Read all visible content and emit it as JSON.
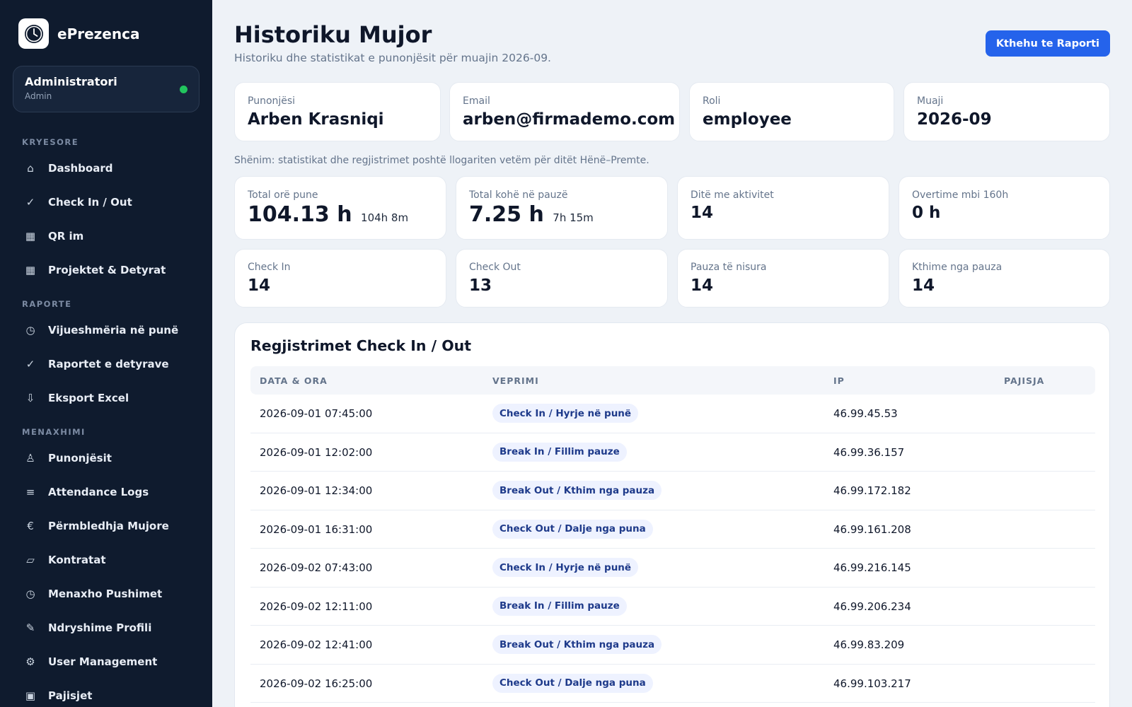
{
  "app": {
    "name": "ePrezenca"
  },
  "user": {
    "name": "Administratori",
    "role": "Admin"
  },
  "sidebar": {
    "sections": [
      {
        "label": "KRYESORE"
      },
      {
        "label": "RAPORTE"
      },
      {
        "label": "MENAXHIMI"
      }
    ],
    "items": [
      {
        "label": "Dashboard",
        "icon": "⌂"
      },
      {
        "label": "Check In / Out",
        "icon": "✓"
      },
      {
        "label": "QR im",
        "icon": "▦"
      },
      {
        "label": "Projektet & Detyrat",
        "icon": "▦"
      },
      {
        "label": "Vijueshmëria në punë",
        "icon": "◷"
      },
      {
        "label": "Raportet e detyrave",
        "icon": "✓"
      },
      {
        "label": "Eksport Excel",
        "icon": "⇩"
      },
      {
        "label": "Punonjësit",
        "icon": "♙"
      },
      {
        "label": "Attendance Logs",
        "icon": "≡"
      },
      {
        "label": "Përmbledhja Mujore",
        "icon": "€"
      },
      {
        "label": "Kontratat",
        "icon": "▱"
      },
      {
        "label": "Menaxho Pushimet",
        "icon": "◷"
      },
      {
        "label": "Ndryshime Profili",
        "icon": "✎"
      },
      {
        "label": "User Management",
        "icon": "⚙"
      },
      {
        "label": "Pajisjet",
        "icon": "▣"
      }
    ]
  },
  "header": {
    "title": "Historiku Mujor",
    "subtitle": "Historiku dhe statistikat e punonjësit për muajin 2026-09.",
    "back_button": "Kthehu te Raporti"
  },
  "info": [
    {
      "label": "Punonjësi",
      "value": "Arben Krasniqi"
    },
    {
      "label": "Email",
      "value": "arben@firmademo.com"
    },
    {
      "label": "Roli",
      "value": "employee"
    },
    {
      "label": "Muaji",
      "value": "2026-09"
    }
  ],
  "note": "Shënim: statistikat dhe regjistrimet poshtë llogariten vetëm për ditët Hënë–Premte.",
  "stats_row1": [
    {
      "label": "Total orë pune",
      "value": "104.13 h",
      "sub": "104h 8m"
    },
    {
      "label": "Total kohë në pauzë",
      "value": "7.25 h",
      "sub": "7h 15m"
    },
    {
      "label": "Ditë me aktivitet",
      "value": "14",
      "sub": ""
    },
    {
      "label": "Overtime mbi 160h",
      "value": "0 h",
      "sub": ""
    }
  ],
  "stats_row2": [
    {
      "label": "Check In",
      "value": "14"
    },
    {
      "label": "Check Out",
      "value": "13"
    },
    {
      "label": "Pauza të nisura",
      "value": "14"
    },
    {
      "label": "Kthime nga pauza",
      "value": "14"
    }
  ],
  "table": {
    "title": "Regjistrimet Check In / Out",
    "columns": [
      "DATA & ORA",
      "VEPRIMI",
      "IP",
      "PAJISJA"
    ],
    "rows": [
      {
        "datetime": "2026-09-01 07:45:00",
        "action": "Check In / Hyrje në punë",
        "ip": "46.99.45.53",
        "device": ""
      },
      {
        "datetime": "2026-09-01 12:02:00",
        "action": "Break In / Fillim pauze",
        "ip": "46.99.36.157",
        "device": ""
      },
      {
        "datetime": "2026-09-01 12:34:00",
        "action": "Break Out / Kthim nga pauza",
        "ip": "46.99.172.182",
        "device": ""
      },
      {
        "datetime": "2026-09-01 16:31:00",
        "action": "Check Out / Dalje nga puna",
        "ip": "46.99.161.208",
        "device": ""
      },
      {
        "datetime": "2026-09-02 07:43:00",
        "action": "Check In / Hyrje në punë",
        "ip": "46.99.216.145",
        "device": ""
      },
      {
        "datetime": "2026-09-02 12:11:00",
        "action": "Break In / Fillim pauze",
        "ip": "46.99.206.234",
        "device": ""
      },
      {
        "datetime": "2026-09-02 12:41:00",
        "action": "Break Out / Kthim nga pauza",
        "ip": "46.99.83.209",
        "device": ""
      },
      {
        "datetime": "2026-09-02 16:25:00",
        "action": "Check Out / Dalje nga puna",
        "ip": "46.99.103.217",
        "device": ""
      }
    ]
  }
}
